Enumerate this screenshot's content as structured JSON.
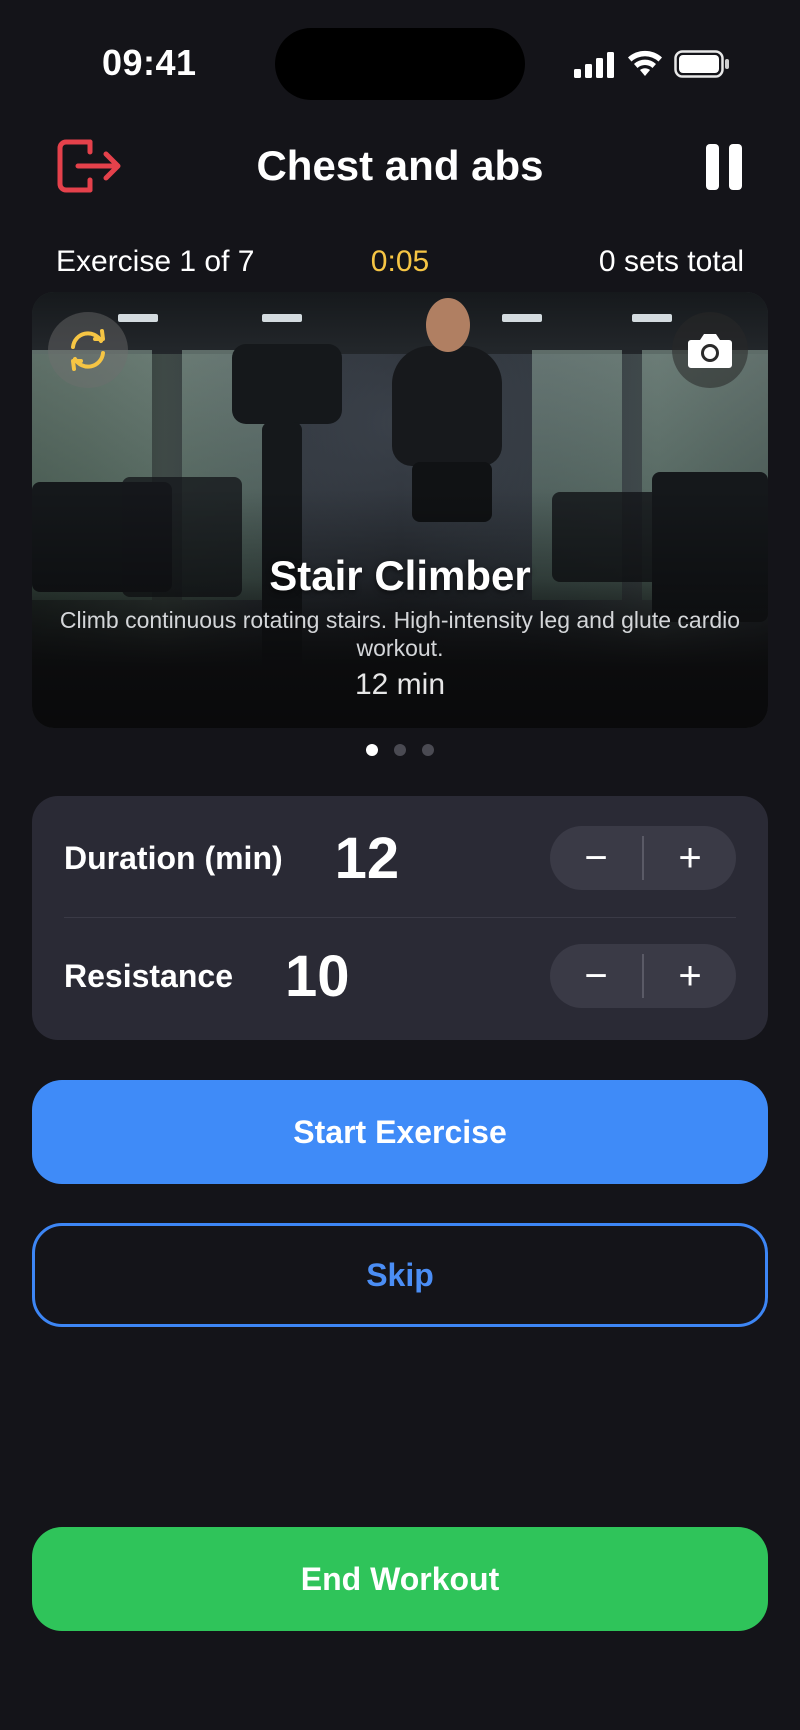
{
  "status_bar": {
    "time": "09:41",
    "icons": [
      "signal-icon",
      "wifi-icon",
      "battery-icon"
    ]
  },
  "header": {
    "title": "Chest and abs",
    "exit_icon": "exit-icon",
    "pause_icon": "pause-icon"
  },
  "progress": {
    "exercise": "Exercise 1 of 7",
    "timer": "0:05",
    "sets": "0 sets total"
  },
  "exercise": {
    "name": "Stair Climber",
    "description": "Climb continuous rotating stairs. High-intensity leg and glute cardio workout.",
    "duration": "12 min",
    "rotate_icon": "rotate-icon",
    "camera_icon": "camera-icon"
  },
  "pager": {
    "count": 3,
    "active": 0
  },
  "settings": {
    "duration_label": "Duration (min)",
    "duration_value": "12",
    "resistance_label": "Resistance",
    "resistance_value": "10",
    "minus": "−",
    "plus": "+"
  },
  "actions": {
    "start": "Start Exercise",
    "skip": "Skip",
    "end": "End Workout"
  },
  "colors": {
    "background": "#141419",
    "accent_blue": "#3f8bf8",
    "end_green": "#2fc45a",
    "timer_yellow": "#f6c544",
    "exit_red": "#e5414b",
    "card": "#2a2a35"
  }
}
